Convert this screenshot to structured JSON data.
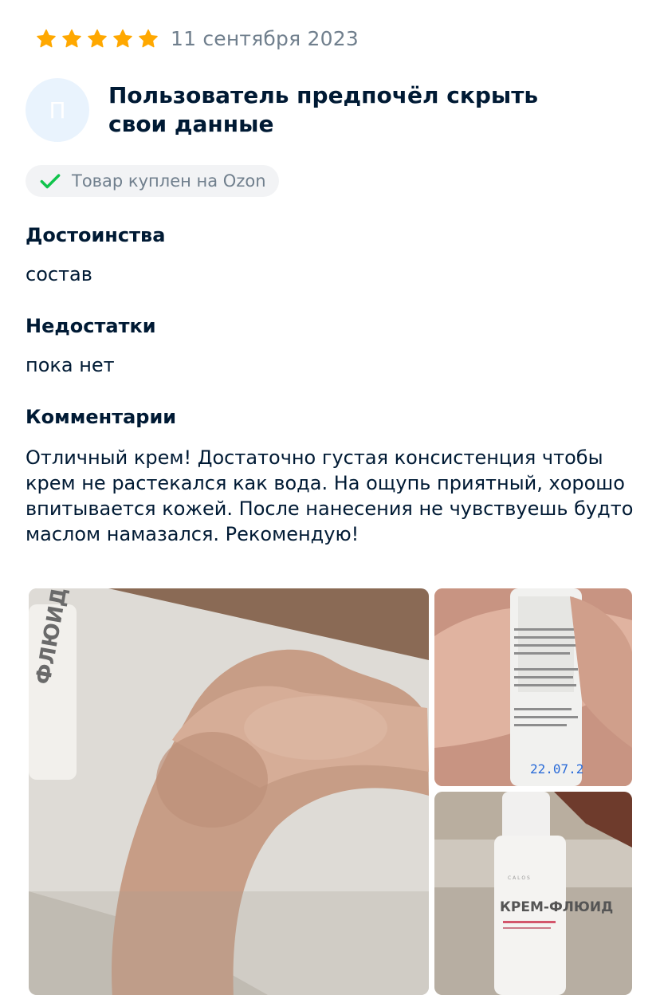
{
  "review": {
    "rating": 5,
    "date": "11 сентября 2023",
    "star_color": "#ffa800",
    "author": {
      "avatar_letter": "П",
      "name": "Пользователь предпочёл скрыть свои данные"
    },
    "badge": {
      "icon": "check-icon",
      "text": "Товар куплен на Ozon",
      "check_color": "#10c44c"
    },
    "pros": {
      "title": "Достоинства",
      "text": "состав"
    },
    "cons": {
      "title": "Недостатки",
      "text": "пока нет"
    },
    "comment": {
      "title": "Комментарии",
      "text": "Отличный крем! Достаточно густая консистенция чтобы крем не растекался как вода. На ощупь приятный, хорошо впитывается кожей. После нанесения не чувствуешь будто маслом намазался. Рекомендую!"
    },
    "photos": [
      {
        "name": "photo-hand-applying-cream",
        "product_label": "ФЛЮИД"
      },
      {
        "name": "photo-bottle-in-hand-back",
        "date_stamp": "22.07.2"
      },
      {
        "name": "photo-bottle-front",
        "product_label": "КРЕМ-ФЛЮИД"
      }
    ]
  }
}
